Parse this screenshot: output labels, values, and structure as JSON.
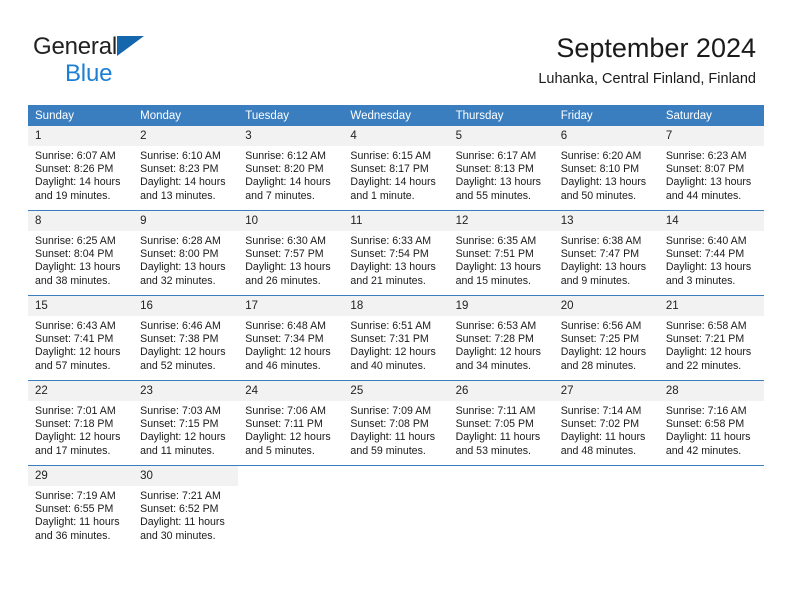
{
  "brand": {
    "name_part1": "General",
    "name_part2": "Blue",
    "logo_icon": "triangle-logo-icon",
    "color_primary": "#1466ad",
    "color_secondary": "#1c7fd4"
  },
  "header": {
    "title": "September 2024",
    "subtitle": "Luhanka, Central Finland, Finland",
    "header_bg_color": "#3b7ec0",
    "daynum_bg_color": "#f2f2f2"
  },
  "weekdays": [
    "Sunday",
    "Monday",
    "Tuesday",
    "Wednesday",
    "Thursday",
    "Friday",
    "Saturday"
  ],
  "weeks": [
    [
      {
        "day": "1",
        "sunrise": "Sunrise: 6:07 AM",
        "sunset": "Sunset: 8:26 PM",
        "daylight": "Daylight: 14 hours and 19 minutes."
      },
      {
        "day": "2",
        "sunrise": "Sunrise: 6:10 AM",
        "sunset": "Sunset: 8:23 PM",
        "daylight": "Daylight: 14 hours and 13 minutes."
      },
      {
        "day": "3",
        "sunrise": "Sunrise: 6:12 AM",
        "sunset": "Sunset: 8:20 PM",
        "daylight": "Daylight: 14 hours and 7 minutes."
      },
      {
        "day": "4",
        "sunrise": "Sunrise: 6:15 AM",
        "sunset": "Sunset: 8:17 PM",
        "daylight": "Daylight: 14 hours and 1 minute."
      },
      {
        "day": "5",
        "sunrise": "Sunrise: 6:17 AM",
        "sunset": "Sunset: 8:13 PM",
        "daylight": "Daylight: 13 hours and 55 minutes."
      },
      {
        "day": "6",
        "sunrise": "Sunrise: 6:20 AM",
        "sunset": "Sunset: 8:10 PM",
        "daylight": "Daylight: 13 hours and 50 minutes."
      },
      {
        "day": "7",
        "sunrise": "Sunrise: 6:23 AM",
        "sunset": "Sunset: 8:07 PM",
        "daylight": "Daylight: 13 hours and 44 minutes."
      }
    ],
    [
      {
        "day": "8",
        "sunrise": "Sunrise: 6:25 AM",
        "sunset": "Sunset: 8:04 PM",
        "daylight": "Daylight: 13 hours and 38 minutes."
      },
      {
        "day": "9",
        "sunrise": "Sunrise: 6:28 AM",
        "sunset": "Sunset: 8:00 PM",
        "daylight": "Daylight: 13 hours and 32 minutes."
      },
      {
        "day": "10",
        "sunrise": "Sunrise: 6:30 AM",
        "sunset": "Sunset: 7:57 PM",
        "daylight": "Daylight: 13 hours and 26 minutes."
      },
      {
        "day": "11",
        "sunrise": "Sunrise: 6:33 AM",
        "sunset": "Sunset: 7:54 PM",
        "daylight": "Daylight: 13 hours and 21 minutes."
      },
      {
        "day": "12",
        "sunrise": "Sunrise: 6:35 AM",
        "sunset": "Sunset: 7:51 PM",
        "daylight": "Daylight: 13 hours and 15 minutes."
      },
      {
        "day": "13",
        "sunrise": "Sunrise: 6:38 AM",
        "sunset": "Sunset: 7:47 PM",
        "daylight": "Daylight: 13 hours and 9 minutes."
      },
      {
        "day": "14",
        "sunrise": "Sunrise: 6:40 AM",
        "sunset": "Sunset: 7:44 PM",
        "daylight": "Daylight: 13 hours and 3 minutes."
      }
    ],
    [
      {
        "day": "15",
        "sunrise": "Sunrise: 6:43 AM",
        "sunset": "Sunset: 7:41 PM",
        "daylight": "Daylight: 12 hours and 57 minutes."
      },
      {
        "day": "16",
        "sunrise": "Sunrise: 6:46 AM",
        "sunset": "Sunset: 7:38 PM",
        "daylight": "Daylight: 12 hours and 52 minutes."
      },
      {
        "day": "17",
        "sunrise": "Sunrise: 6:48 AM",
        "sunset": "Sunset: 7:34 PM",
        "daylight": "Daylight: 12 hours and 46 minutes."
      },
      {
        "day": "18",
        "sunrise": "Sunrise: 6:51 AM",
        "sunset": "Sunset: 7:31 PM",
        "daylight": "Daylight: 12 hours and 40 minutes."
      },
      {
        "day": "19",
        "sunrise": "Sunrise: 6:53 AM",
        "sunset": "Sunset: 7:28 PM",
        "daylight": "Daylight: 12 hours and 34 minutes."
      },
      {
        "day": "20",
        "sunrise": "Sunrise: 6:56 AM",
        "sunset": "Sunset: 7:25 PM",
        "daylight": "Daylight: 12 hours and 28 minutes."
      },
      {
        "day": "21",
        "sunrise": "Sunrise: 6:58 AM",
        "sunset": "Sunset: 7:21 PM",
        "daylight": "Daylight: 12 hours and 22 minutes."
      }
    ],
    [
      {
        "day": "22",
        "sunrise": "Sunrise: 7:01 AM",
        "sunset": "Sunset: 7:18 PM",
        "daylight": "Daylight: 12 hours and 17 minutes."
      },
      {
        "day": "23",
        "sunrise": "Sunrise: 7:03 AM",
        "sunset": "Sunset: 7:15 PM",
        "daylight": "Daylight: 12 hours and 11 minutes."
      },
      {
        "day": "24",
        "sunrise": "Sunrise: 7:06 AM",
        "sunset": "Sunset: 7:11 PM",
        "daylight": "Daylight: 12 hours and 5 minutes."
      },
      {
        "day": "25",
        "sunrise": "Sunrise: 7:09 AM",
        "sunset": "Sunset: 7:08 PM",
        "daylight": "Daylight: 11 hours and 59 minutes."
      },
      {
        "day": "26",
        "sunrise": "Sunrise: 7:11 AM",
        "sunset": "Sunset: 7:05 PM",
        "daylight": "Daylight: 11 hours and 53 minutes."
      },
      {
        "day": "27",
        "sunrise": "Sunrise: 7:14 AM",
        "sunset": "Sunset: 7:02 PM",
        "daylight": "Daylight: 11 hours and 48 minutes."
      },
      {
        "day": "28",
        "sunrise": "Sunrise: 7:16 AM",
        "sunset": "Sunset: 6:58 PM",
        "daylight": "Daylight: 11 hours and 42 minutes."
      }
    ],
    [
      {
        "day": "29",
        "sunrise": "Sunrise: 7:19 AM",
        "sunset": "Sunset: 6:55 PM",
        "daylight": "Daylight: 11 hours and 36 minutes."
      },
      {
        "day": "30",
        "sunrise": "Sunrise: 7:21 AM",
        "sunset": "Sunset: 6:52 PM",
        "daylight": "Daylight: 11 hours and 30 minutes."
      },
      {
        "day": "",
        "sunrise": "",
        "sunset": "",
        "daylight": ""
      },
      {
        "day": "",
        "sunrise": "",
        "sunset": "",
        "daylight": ""
      },
      {
        "day": "",
        "sunrise": "",
        "sunset": "",
        "daylight": ""
      },
      {
        "day": "",
        "sunrise": "",
        "sunset": "",
        "daylight": ""
      },
      {
        "day": "",
        "sunrise": "",
        "sunset": "",
        "daylight": ""
      }
    ]
  ]
}
